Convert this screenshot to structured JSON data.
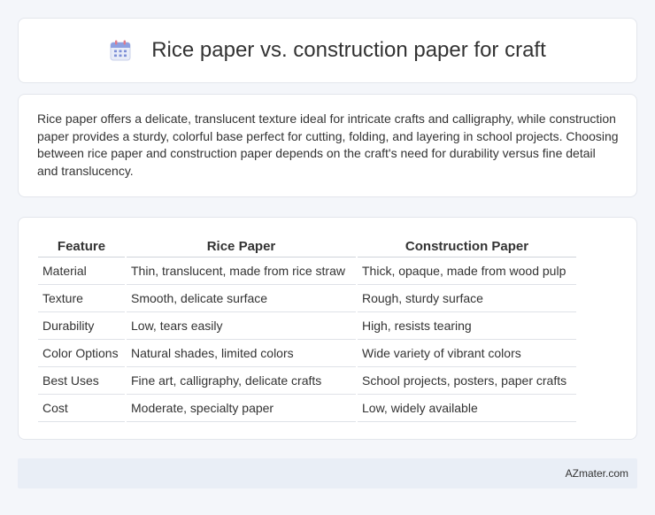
{
  "header": {
    "title": "Rice paper vs. construction paper for craft",
    "icon": "calendar-icon"
  },
  "intro": {
    "text": "Rice paper offers a delicate, translucent texture ideal for intricate crafts and calligraphy, while construction paper provides a sturdy, colorful base perfect for cutting, folding, and layering in school projects. Choosing between rice paper and construction paper depends on the craft's need for durability versus fine detail and translucency."
  },
  "table": {
    "headers": [
      "Feature",
      "Rice Paper",
      "Construction Paper"
    ],
    "rows": [
      [
        "Material",
        "Thin, translucent, made from rice straw",
        "Thick, opaque, made from wood pulp"
      ],
      [
        "Texture",
        "Smooth, delicate surface",
        "Rough, sturdy surface"
      ],
      [
        "Durability",
        "Low, tears easily",
        "High, resists tearing"
      ],
      [
        "Color Options",
        "Natural shades, limited colors",
        "Wide variety of vibrant colors"
      ],
      [
        "Best Uses",
        "Fine art, calligraphy, delicate crafts",
        "School projects, posters, paper crafts"
      ],
      [
        "Cost",
        "Moderate, specialty paper",
        "Low, widely available"
      ]
    ]
  },
  "footer": {
    "site": "AZmater.com"
  }
}
